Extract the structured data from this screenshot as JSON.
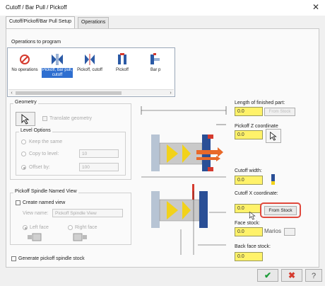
{
  "window": {
    "title": "Cutoff / Bar Pull / Pickoff",
    "close_icon": "close-icon"
  },
  "tabs": [
    {
      "label": "Cutoff/Pickoff/Bar Pull Setup",
      "active": true
    },
    {
      "label": "Operations",
      "active": false
    }
  ],
  "operations": {
    "group_label": "Operations to program",
    "items": [
      {
        "label": "No operations",
        "icon": "no-entry-icon",
        "selected": false
      },
      {
        "label": "Pickoff, bar pull, cutoff",
        "icon": "bar-pull-icon",
        "selected": true
      },
      {
        "label": "Pickoff, cutoff",
        "icon": "pickoff-cutoff-icon",
        "selected": false
      },
      {
        "label": "Pickoff",
        "icon": "pickoff-icon",
        "selected": false
      },
      {
        "label": "Bar p",
        "icon": "bar-pull-icon",
        "selected": false
      }
    ]
  },
  "geometry": {
    "group_label": "Geometry",
    "translate_label": "Translate geometry",
    "level_options": {
      "group_label": "Level Options",
      "keep_same": "Keep the same",
      "copy_to_level": "Copy to level:",
      "copy_to_level_value": "10",
      "offset_by": "Offset by:",
      "offset_by_value": "100"
    }
  },
  "named_view": {
    "group_label": "Pickoff Spindle Named View",
    "create_label": "Create named view",
    "view_name_label": "View name:",
    "view_name_value": "Pickoff Spindle View",
    "left_face": "Left face",
    "right_face": "Right face"
  },
  "generate_stock_label": "Generate pickoff spindle stock",
  "right_fields": {
    "finished_length_label": "Length of finished part:",
    "finished_length_value": "0.0",
    "from_stock_disabled": "From Stock",
    "pickoff_z_label": "Pickoff Z coordinate",
    "pickoff_z_value": "0.0",
    "cutoff_width_label": "Cutoff width:",
    "cutoff_width_value": "0.0",
    "cutoff_x_label": "Cutoff X coordinate:",
    "cutoff_x_value": "0.0",
    "from_stock_button": "From Stock",
    "face_stock_label": "Face stock:",
    "face_stock_value": "0.0",
    "face_stock_suffix": "Marios",
    "back_face_label": "Back face stock:",
    "back_face_value": "0.0"
  },
  "footer": {
    "ok_icon": "checkmark-icon",
    "cancel_icon": "red-x-icon",
    "help_icon": "help-icon"
  },
  "colors": {
    "accent": "#2f6fd0",
    "field_yellow": "#fff26a",
    "highlight_red": "#e0483d"
  }
}
